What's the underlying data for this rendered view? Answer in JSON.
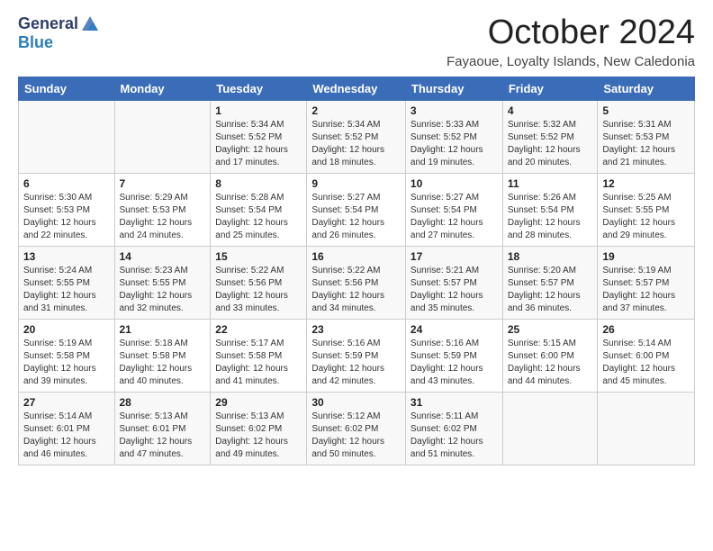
{
  "logo": {
    "line1": "General",
    "line2": "Blue"
  },
  "header": {
    "month": "October 2024",
    "location": "Fayaoue, Loyalty Islands, New Caledonia"
  },
  "weekdays": [
    "Sunday",
    "Monday",
    "Tuesday",
    "Wednesday",
    "Thursday",
    "Friday",
    "Saturday"
  ],
  "weeks": [
    [
      {
        "day": "",
        "sunrise": "",
        "sunset": "",
        "daylight": ""
      },
      {
        "day": "",
        "sunrise": "",
        "sunset": "",
        "daylight": ""
      },
      {
        "day": "1",
        "sunrise": "Sunrise: 5:34 AM",
        "sunset": "Sunset: 5:52 PM",
        "daylight": "Daylight: 12 hours and 17 minutes."
      },
      {
        "day": "2",
        "sunrise": "Sunrise: 5:34 AM",
        "sunset": "Sunset: 5:52 PM",
        "daylight": "Daylight: 12 hours and 18 minutes."
      },
      {
        "day": "3",
        "sunrise": "Sunrise: 5:33 AM",
        "sunset": "Sunset: 5:52 PM",
        "daylight": "Daylight: 12 hours and 19 minutes."
      },
      {
        "day": "4",
        "sunrise": "Sunrise: 5:32 AM",
        "sunset": "Sunset: 5:52 PM",
        "daylight": "Daylight: 12 hours and 20 minutes."
      },
      {
        "day": "5",
        "sunrise": "Sunrise: 5:31 AM",
        "sunset": "Sunset: 5:53 PM",
        "daylight": "Daylight: 12 hours and 21 minutes."
      }
    ],
    [
      {
        "day": "6",
        "sunrise": "Sunrise: 5:30 AM",
        "sunset": "Sunset: 5:53 PM",
        "daylight": "Daylight: 12 hours and 22 minutes."
      },
      {
        "day": "7",
        "sunrise": "Sunrise: 5:29 AM",
        "sunset": "Sunset: 5:53 PM",
        "daylight": "Daylight: 12 hours and 24 minutes."
      },
      {
        "day": "8",
        "sunrise": "Sunrise: 5:28 AM",
        "sunset": "Sunset: 5:54 PM",
        "daylight": "Daylight: 12 hours and 25 minutes."
      },
      {
        "day": "9",
        "sunrise": "Sunrise: 5:27 AM",
        "sunset": "Sunset: 5:54 PM",
        "daylight": "Daylight: 12 hours and 26 minutes."
      },
      {
        "day": "10",
        "sunrise": "Sunrise: 5:27 AM",
        "sunset": "Sunset: 5:54 PM",
        "daylight": "Daylight: 12 hours and 27 minutes."
      },
      {
        "day": "11",
        "sunrise": "Sunrise: 5:26 AM",
        "sunset": "Sunset: 5:54 PM",
        "daylight": "Daylight: 12 hours and 28 minutes."
      },
      {
        "day": "12",
        "sunrise": "Sunrise: 5:25 AM",
        "sunset": "Sunset: 5:55 PM",
        "daylight": "Daylight: 12 hours and 29 minutes."
      }
    ],
    [
      {
        "day": "13",
        "sunrise": "Sunrise: 5:24 AM",
        "sunset": "Sunset: 5:55 PM",
        "daylight": "Daylight: 12 hours and 31 minutes."
      },
      {
        "day": "14",
        "sunrise": "Sunrise: 5:23 AM",
        "sunset": "Sunset: 5:55 PM",
        "daylight": "Daylight: 12 hours and 32 minutes."
      },
      {
        "day": "15",
        "sunrise": "Sunrise: 5:22 AM",
        "sunset": "Sunset: 5:56 PM",
        "daylight": "Daylight: 12 hours and 33 minutes."
      },
      {
        "day": "16",
        "sunrise": "Sunrise: 5:22 AM",
        "sunset": "Sunset: 5:56 PM",
        "daylight": "Daylight: 12 hours and 34 minutes."
      },
      {
        "day": "17",
        "sunrise": "Sunrise: 5:21 AM",
        "sunset": "Sunset: 5:57 PM",
        "daylight": "Daylight: 12 hours and 35 minutes."
      },
      {
        "day": "18",
        "sunrise": "Sunrise: 5:20 AM",
        "sunset": "Sunset: 5:57 PM",
        "daylight": "Daylight: 12 hours and 36 minutes."
      },
      {
        "day": "19",
        "sunrise": "Sunrise: 5:19 AM",
        "sunset": "Sunset: 5:57 PM",
        "daylight": "Daylight: 12 hours and 37 minutes."
      }
    ],
    [
      {
        "day": "20",
        "sunrise": "Sunrise: 5:19 AM",
        "sunset": "Sunset: 5:58 PM",
        "daylight": "Daylight: 12 hours and 39 minutes."
      },
      {
        "day": "21",
        "sunrise": "Sunrise: 5:18 AM",
        "sunset": "Sunset: 5:58 PM",
        "daylight": "Daylight: 12 hours and 40 minutes."
      },
      {
        "day": "22",
        "sunrise": "Sunrise: 5:17 AM",
        "sunset": "Sunset: 5:58 PM",
        "daylight": "Daylight: 12 hours and 41 minutes."
      },
      {
        "day": "23",
        "sunrise": "Sunrise: 5:16 AM",
        "sunset": "Sunset: 5:59 PM",
        "daylight": "Daylight: 12 hours and 42 minutes."
      },
      {
        "day": "24",
        "sunrise": "Sunrise: 5:16 AM",
        "sunset": "Sunset: 5:59 PM",
        "daylight": "Daylight: 12 hours and 43 minutes."
      },
      {
        "day": "25",
        "sunrise": "Sunrise: 5:15 AM",
        "sunset": "Sunset: 6:00 PM",
        "daylight": "Daylight: 12 hours and 44 minutes."
      },
      {
        "day": "26",
        "sunrise": "Sunrise: 5:14 AM",
        "sunset": "Sunset: 6:00 PM",
        "daylight": "Daylight: 12 hours and 45 minutes."
      }
    ],
    [
      {
        "day": "27",
        "sunrise": "Sunrise: 5:14 AM",
        "sunset": "Sunset: 6:01 PM",
        "daylight": "Daylight: 12 hours and 46 minutes."
      },
      {
        "day": "28",
        "sunrise": "Sunrise: 5:13 AM",
        "sunset": "Sunset: 6:01 PM",
        "daylight": "Daylight: 12 hours and 47 minutes."
      },
      {
        "day": "29",
        "sunrise": "Sunrise: 5:13 AM",
        "sunset": "Sunset: 6:02 PM",
        "daylight": "Daylight: 12 hours and 49 minutes."
      },
      {
        "day": "30",
        "sunrise": "Sunrise: 5:12 AM",
        "sunset": "Sunset: 6:02 PM",
        "daylight": "Daylight: 12 hours and 50 minutes."
      },
      {
        "day": "31",
        "sunrise": "Sunrise: 5:11 AM",
        "sunset": "Sunset: 6:02 PM",
        "daylight": "Daylight: 12 hours and 51 minutes."
      },
      {
        "day": "",
        "sunrise": "",
        "sunset": "",
        "daylight": ""
      },
      {
        "day": "",
        "sunrise": "",
        "sunset": "",
        "daylight": ""
      }
    ]
  ]
}
